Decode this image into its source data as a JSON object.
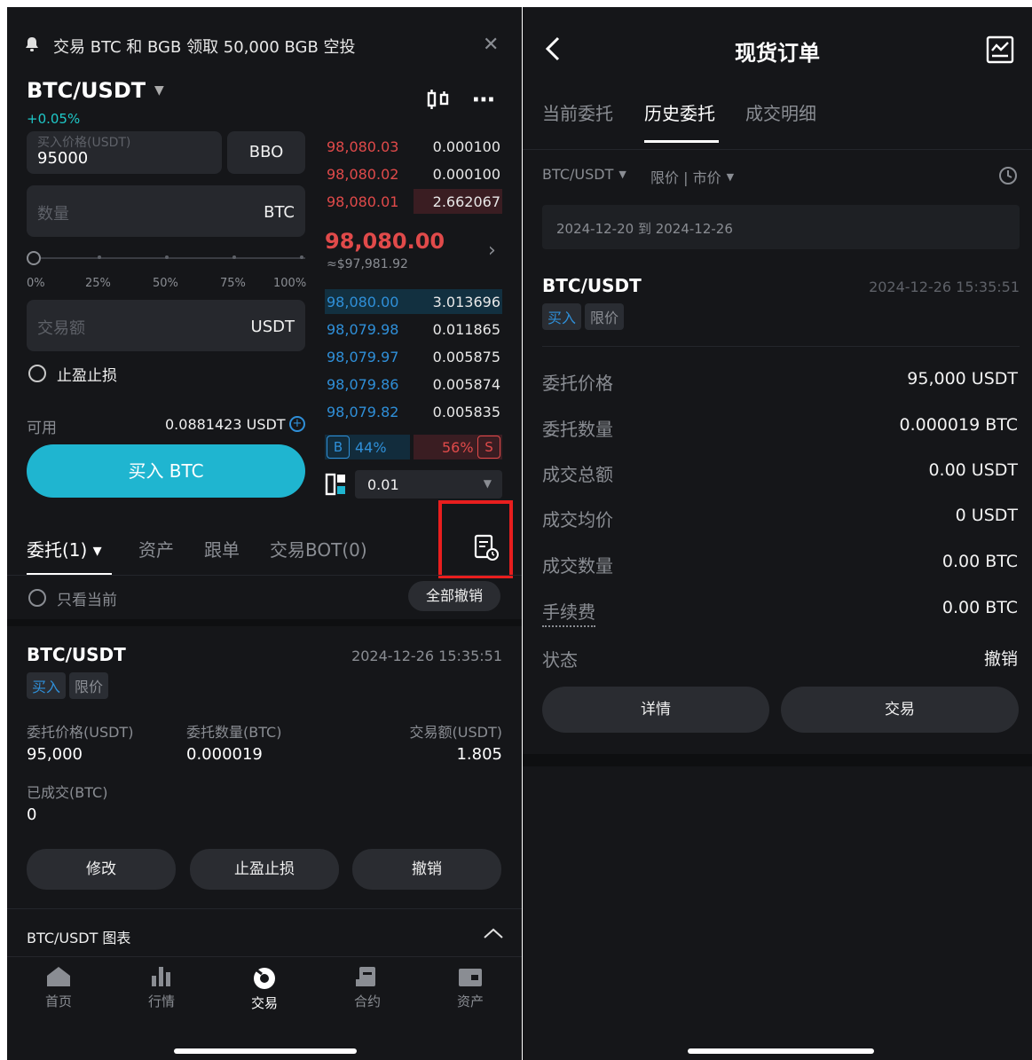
{
  "left": {
    "banner": {
      "text": "交易 BTC 和 BGB 领取 50,000 BGB 空投"
    },
    "pair": {
      "name": "BTC/USDT",
      "change": "+0.05%"
    },
    "form": {
      "price_label": "买入价格(USDT)",
      "price_value": "95000",
      "bbo_label": "BBO",
      "qty_placeholder": "数量",
      "qty_unit": "BTC",
      "slider_marks": [
        "0%",
        "25%",
        "50%",
        "75%",
        "100%"
      ],
      "amount_placeholder": "交易额",
      "amount_unit": "USDT",
      "tpsl_label": "止盈止损",
      "available_label": "可用",
      "available_value": "0.0881423 USDT",
      "buy_button": "买入 BTC"
    },
    "orderbook": {
      "asks": [
        {
          "price": "98,080.03",
          "qty": "0.000100"
        },
        {
          "price": "98,080.02",
          "qty": "0.000100"
        },
        {
          "price": "98,080.01",
          "qty": "2.662067"
        }
      ],
      "last_price": "98,080.00",
      "last_price_usd": "≈$97,981.92",
      "bids": [
        {
          "price": "98,080.00",
          "qty": "3.013696"
        },
        {
          "price": "98,079.98",
          "qty": "0.011865"
        },
        {
          "price": "98,079.97",
          "qty": "0.005875"
        },
        {
          "price": "98,079.86",
          "qty": "0.005874"
        },
        {
          "price": "98,079.82",
          "qty": "0.005835"
        }
      ],
      "buy_ratio_label": "B",
      "buy_ratio": "44%",
      "sell_ratio": "56%",
      "sell_ratio_label": "S",
      "precision": "0.01"
    },
    "tabs": [
      "委托(1) ▾",
      "资产",
      "跟单",
      "交易BOT(0)"
    ],
    "filter_label": "只看当前",
    "cancel_all": "全部撤销",
    "order": {
      "pair": "BTC/USDT",
      "time": "2024-12-26 15:35:51",
      "side": "买入",
      "type": "限价",
      "price_label": "委托价格(USDT)",
      "price_value": "95,000",
      "qty_label": "委托数量(BTC)",
      "qty_value": "0.000019",
      "amount_label": "交易额(USDT)",
      "amount_value": "1.805",
      "filled_label": "已成交(BTC)",
      "filled_value": "0",
      "btn_modify": "修改",
      "btn_tpsl": "止盈止损",
      "btn_cancel": "撤销"
    },
    "chart_bar_label": "BTC/USDT 图表",
    "nav": [
      "首页",
      "行情",
      "交易",
      "合约",
      "资产"
    ]
  },
  "right": {
    "title": "现货订单",
    "tabs": [
      "当前委托",
      "历史委托",
      "成交明细"
    ],
    "filter_pair": "BTC/USDT",
    "filter_type": "限价 | 市价",
    "date_range": "2024-12-20 到 2024-12-26",
    "order": {
      "pair": "BTC/USDT",
      "time": "2024-12-26 15:35:51",
      "side": "买入",
      "type": "限价"
    },
    "details": [
      {
        "label": "委托价格",
        "value": "95,000 USDT"
      },
      {
        "label": "委托数量",
        "value": "0.000019 BTC"
      },
      {
        "label": "成交总额",
        "value": "0.00 USDT"
      },
      {
        "label": "成交均价",
        "value": "0 USDT"
      },
      {
        "label": "成交数量",
        "value": "0.00 BTC"
      },
      {
        "label": "手续费",
        "value": "0.00 BTC"
      },
      {
        "label": "状态",
        "value": "撤销"
      }
    ],
    "btn_detail": "详情",
    "btn_trade": "交易"
  }
}
